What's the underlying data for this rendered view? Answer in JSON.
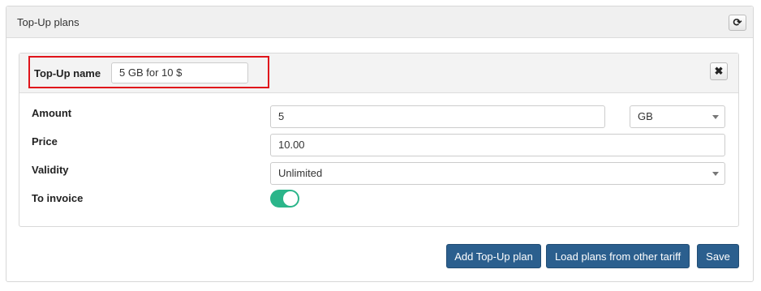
{
  "panel": {
    "title": "Top-Up plans",
    "refresh_icon": "refresh-icon"
  },
  "plan": {
    "name_label": "Top-Up name",
    "name_value": "5 GB for 10 $",
    "close_icon": "close-icon",
    "close_glyph": "✖",
    "amount_label": "Amount",
    "amount_value": "5",
    "unit_value": "GB",
    "price_label": "Price",
    "price_value": "10.00",
    "validity_label": "Validity",
    "validity_value": "Unlimited",
    "invoice_label": "To invoice",
    "invoice_enabled": true
  },
  "actions": {
    "add_label": "Add Top-Up plan",
    "load_label": "Load plans from other tariff",
    "save_label": "Save"
  },
  "colors": {
    "primary_button": "#2b5f8e",
    "toggle_on": "#2bb58a",
    "highlight": "#e0141b"
  }
}
